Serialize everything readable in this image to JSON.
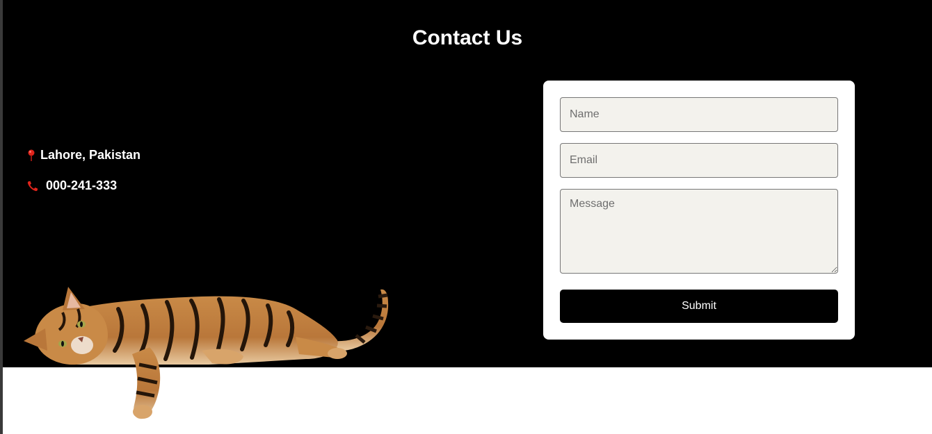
{
  "section": {
    "title": "Contact Us"
  },
  "info": {
    "location": {
      "icon": "map-pin-icon",
      "text": "Lahore, Pakistan"
    },
    "phone": {
      "icon": "phone-icon",
      "text": "000-241-333"
    }
  },
  "form": {
    "name_placeholder": "Name",
    "email_placeholder": "Email",
    "message_placeholder": "Message",
    "submit_label": "Submit"
  },
  "colors": {
    "section_background": "#000000",
    "page_background": "#ffffff",
    "field_background": "#f3f2ed",
    "icon_red": "#e0241b",
    "button_background": "#000000"
  }
}
